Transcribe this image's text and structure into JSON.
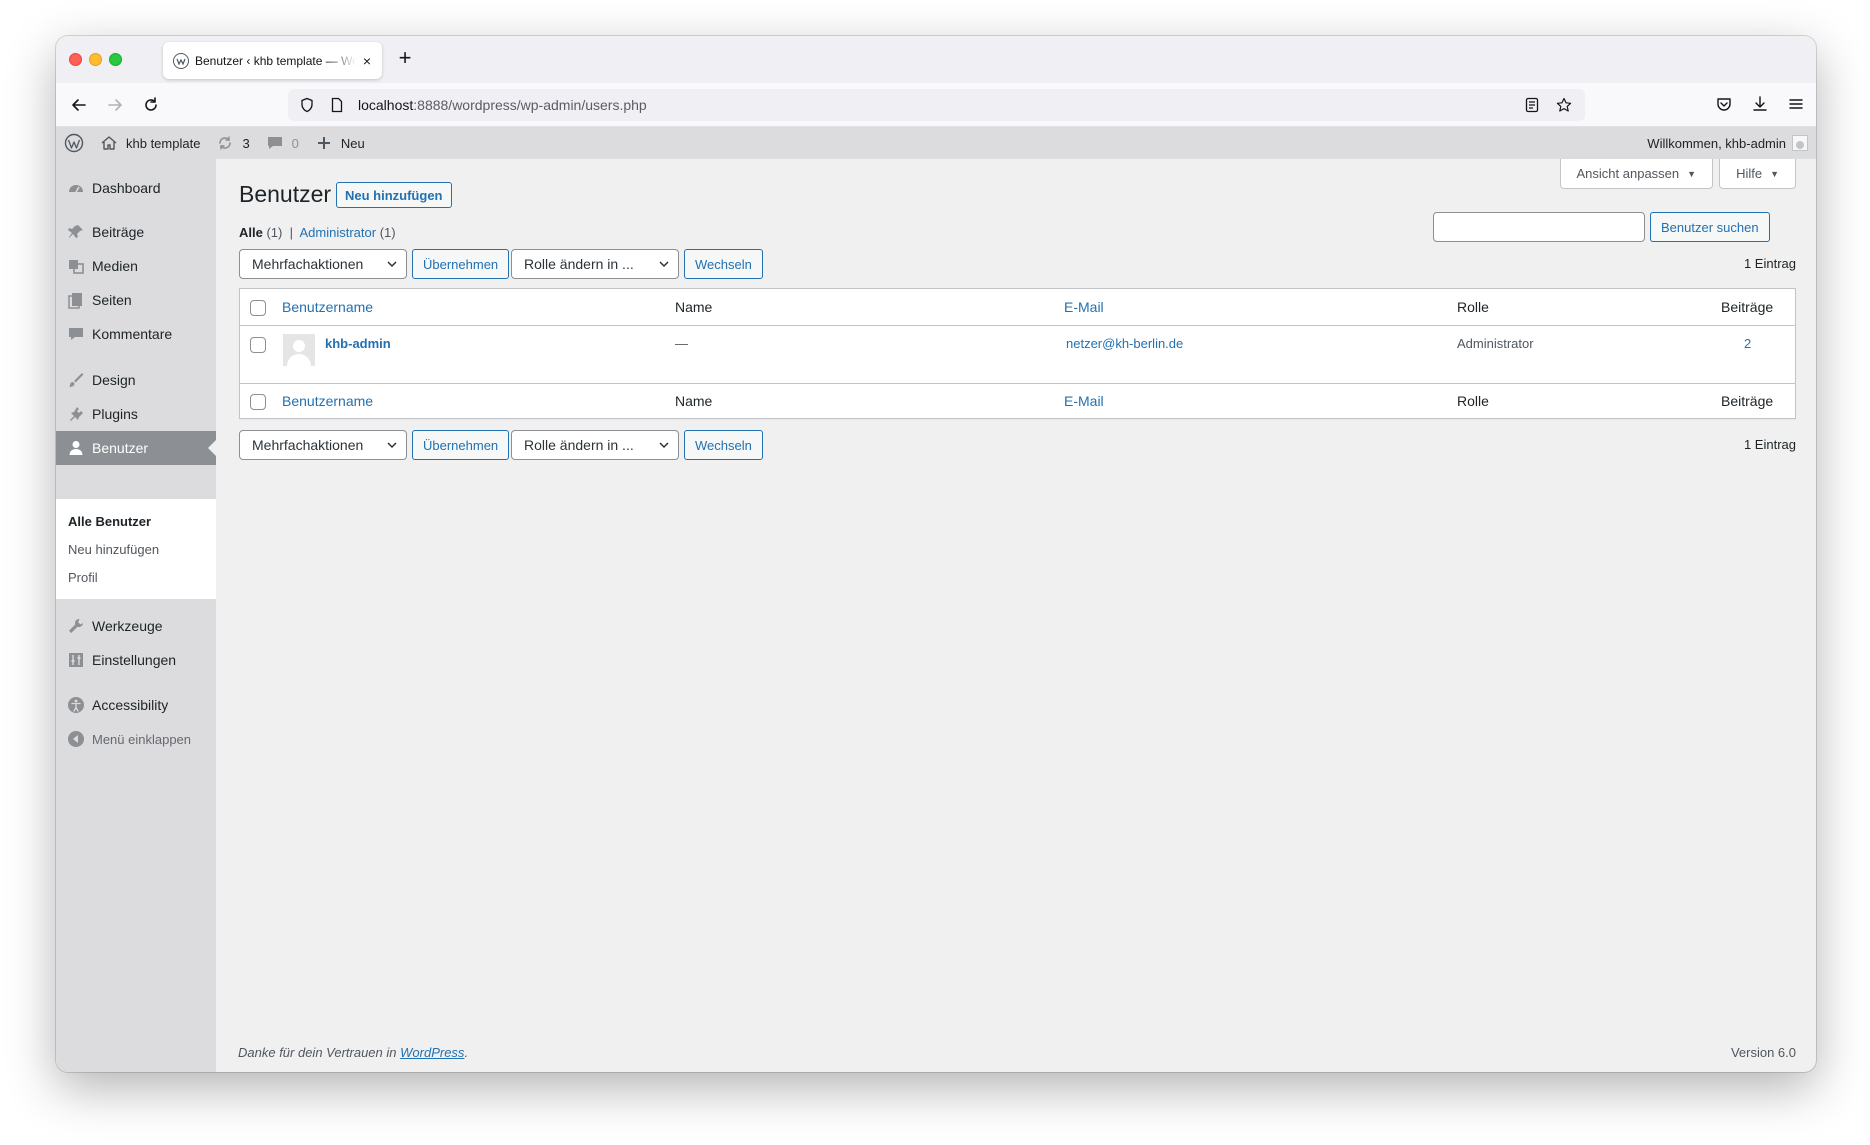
{
  "browser": {
    "tab_title": "Benutzer ‹ khb template — WordPress",
    "url_host": "localhost",
    "url_rest": ":8888/wordpress/wp-admin/users.php"
  },
  "adminbar": {
    "site_name": "khb template",
    "updates_count": "3",
    "comments_count": "0",
    "new_label": "Neu",
    "greeting": "Willkommen, khb-admin"
  },
  "sidebar": {
    "items": [
      {
        "label": "Dashboard",
        "icon": "dashboard-icon"
      },
      {
        "label": "Beiträge",
        "icon": "pin-icon"
      },
      {
        "label": "Medien",
        "icon": "media-icon"
      },
      {
        "label": "Seiten",
        "icon": "pages-icon"
      },
      {
        "label": "Kommentare",
        "icon": "comment-icon"
      },
      {
        "label": "Design",
        "icon": "brush-icon"
      },
      {
        "label": "Plugins",
        "icon": "plug-icon"
      },
      {
        "label": "Benutzer",
        "icon": "user-icon"
      },
      {
        "label": "Werkzeuge",
        "icon": "wrench-icon"
      },
      {
        "label": "Einstellungen",
        "icon": "settings-icon"
      },
      {
        "label": "Accessibility",
        "icon": "accessibility-icon"
      },
      {
        "label": "Menü einklappen",
        "icon": "collapse-icon"
      }
    ],
    "submenu": [
      "Alle Benutzer",
      "Neu hinzufügen",
      "Profil"
    ]
  },
  "main": {
    "screen_options": "Ansicht anpassen",
    "help": "Hilfe",
    "title": "Benutzer",
    "add_new": "Neu hinzufügen",
    "filter_all": "Alle",
    "filter_all_count": "(1)",
    "filter_separator": "|",
    "filter_admin": "Administrator",
    "filter_admin_count": "(1)",
    "search_value": "",
    "search_button": "Benutzer suchen",
    "bulk_actions": "Mehrfachaktionen",
    "apply": "Übernehmen",
    "change_role": "Rolle ändern in ...",
    "change": "Wechseln",
    "item_count": "1 Eintrag",
    "columns": [
      "Benutzername",
      "Name",
      "E-Mail",
      "Rolle",
      "Beiträge"
    ],
    "rows": [
      {
        "username": "khb-admin",
        "name": "—",
        "email": "netzer@kh-berlin.de",
        "role": "Administrator",
        "posts": "2"
      }
    ]
  },
  "footer": {
    "thanks_prefix": "Danke für dein Vertrauen in",
    "thanks_link": "WordPress",
    "thanks_suffix": ".",
    "version": "Version 6.0"
  }
}
